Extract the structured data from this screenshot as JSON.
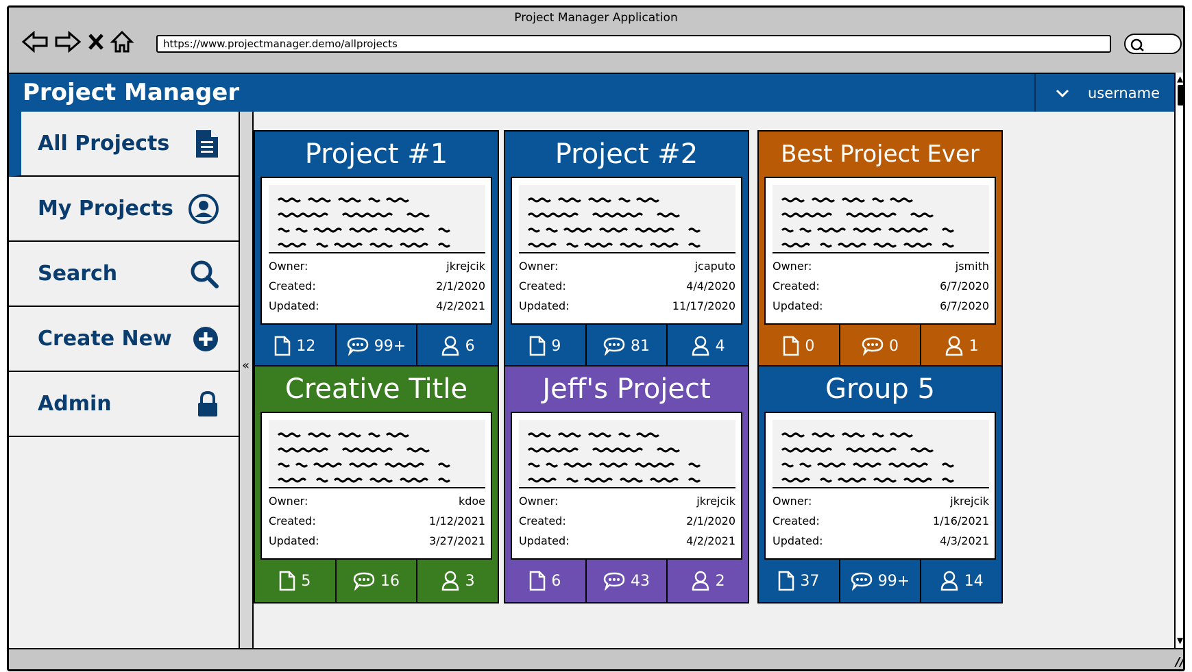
{
  "window": {
    "title": "Project Manager Application",
    "url": "https://www.projectmanager.demo/allprojects"
  },
  "app": {
    "title": "Project Manager",
    "username": "username"
  },
  "sidebar": {
    "items": [
      {
        "label": "All Projects",
        "icon": "document-icon",
        "active": true
      },
      {
        "label": "My Projects",
        "icon": "user-circle-icon",
        "active": false
      },
      {
        "label": "Search",
        "icon": "search-icon",
        "active": false
      },
      {
        "label": "Create New",
        "icon": "plus-circle-icon",
        "active": false
      },
      {
        "label": "Admin",
        "icon": "lock-icon",
        "active": false
      }
    ]
  },
  "labels": {
    "owner": "Owner:",
    "created": "Created:",
    "updated": "Updated:"
  },
  "colors": {
    "blue": "#0a5598",
    "orange": "#b85a06",
    "green": "#3a7d20",
    "purple": "#6c4fb0"
  },
  "projects": [
    {
      "title": "Project #1",
      "owner": "jkrejcik",
      "created": "2/1/2020",
      "updated": "4/2/2021",
      "files": "12",
      "comments": "99+",
      "members": "6",
      "color": "#0a5598"
    },
    {
      "title": "Project #2",
      "owner": "jcaputo",
      "created": "4/4/2020",
      "updated": "11/17/2020",
      "files": "9",
      "comments": "81",
      "members": "4",
      "color": "#0a5598"
    },
    {
      "title": "Best Project Ever",
      "owner": "jsmith",
      "created": "6/7/2020",
      "updated": "6/7/2020",
      "files": "0",
      "comments": "0",
      "members": "1",
      "color": "#b85a06"
    },
    {
      "title": "Creative Title",
      "owner": "kdoe",
      "created": "1/12/2021",
      "updated": "3/27/2021",
      "files": "5",
      "comments": "16",
      "members": "3",
      "color": "#3a7d20"
    },
    {
      "title": "Jeff's Project",
      "owner": "jkrejcik",
      "created": "2/1/2020",
      "updated": "4/2/2021",
      "files": "6",
      "comments": "43",
      "members": "2",
      "color": "#6c4fb0"
    },
    {
      "title": "Group 5",
      "owner": "jkrejcik",
      "created": "1/16/2021",
      "updated": "4/3/2021",
      "files": "37",
      "comments": "99+",
      "members": "14",
      "color": "#0a5598"
    }
  ]
}
